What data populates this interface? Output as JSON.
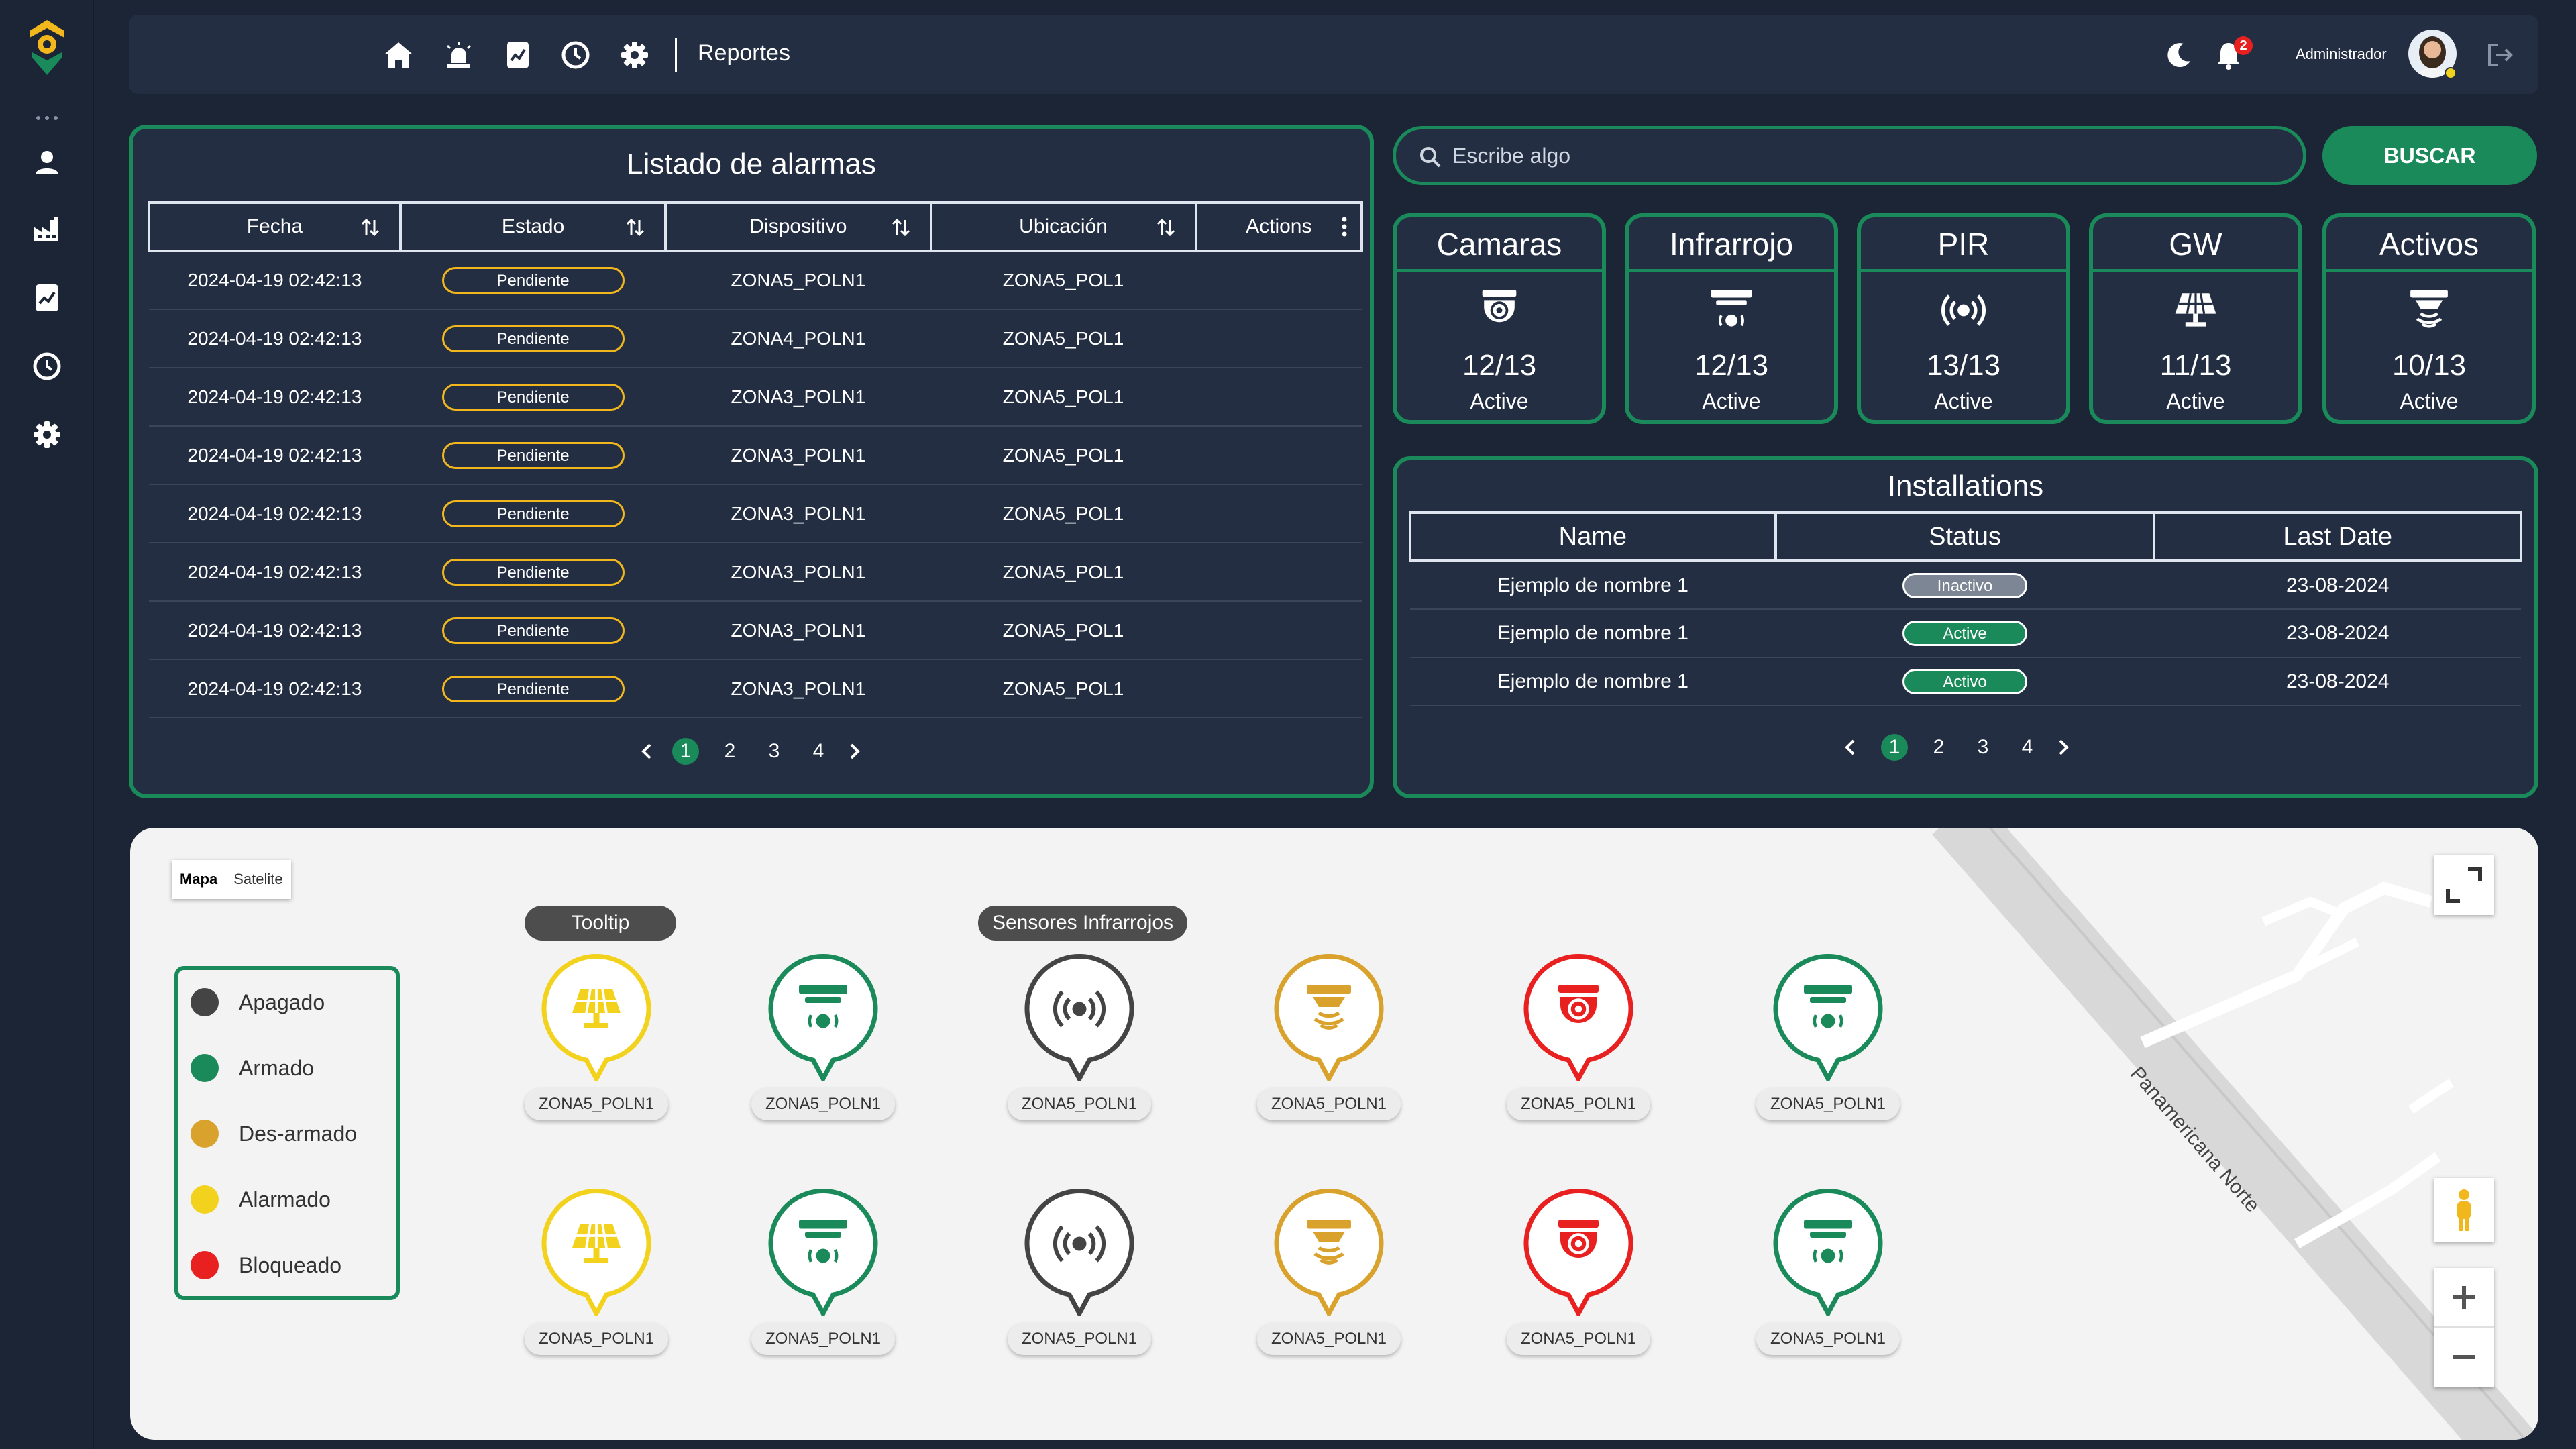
{
  "header": {
    "section_title": "Reportes",
    "user_name": "Administrador",
    "notification_count": "2"
  },
  "alarms": {
    "title": "Listado de alarmas",
    "columns": [
      "Fecha",
      "Estado",
      "Dispositivo",
      "Ubicación",
      "Actions"
    ],
    "rows": [
      {
        "fecha": "2024-04-19 02:42:13",
        "estado": "Pendiente",
        "dispositivo": "ZONA5_POLN1",
        "ubicacion": "ZONA5_POL1"
      },
      {
        "fecha": "2024-04-19 02:42:13",
        "estado": "Pendiente",
        "dispositivo": "ZONA4_POLN1",
        "ubicacion": "ZONA5_POL1"
      },
      {
        "fecha": "2024-04-19 02:42:13",
        "estado": "Pendiente",
        "dispositivo": "ZONA3_POLN1",
        "ubicacion": "ZONA5_POL1"
      },
      {
        "fecha": "2024-04-19 02:42:13",
        "estado": "Pendiente",
        "dispositivo": "ZONA3_POLN1",
        "ubicacion": "ZONA5_POL1"
      },
      {
        "fecha": "2024-04-19 02:42:13",
        "estado": "Pendiente",
        "dispositivo": "ZONA3_POLN1",
        "ubicacion": "ZONA5_POL1"
      },
      {
        "fecha": "2024-04-19 02:42:13",
        "estado": "Pendiente",
        "dispositivo": "ZONA3_POLN1",
        "ubicacion": "ZONA5_POL1"
      },
      {
        "fecha": "2024-04-19 02:42:13",
        "estado": "Pendiente",
        "dispositivo": "ZONA3_POLN1",
        "ubicacion": "ZONA5_POL1"
      },
      {
        "fecha": "2024-04-19 02:42:13",
        "estado": "Pendiente",
        "dispositivo": "ZONA3_POLN1",
        "ubicacion": "ZONA5_POL1"
      }
    ],
    "pages": [
      "1",
      "2",
      "3",
      "4"
    ]
  },
  "search": {
    "placeholder": "Escribe algo",
    "button_label": "BUSCAR"
  },
  "stats": [
    {
      "title": "Camaras",
      "value": "12/13",
      "sub": "Active",
      "icon": "dome-camera-icon"
    },
    {
      "title": "Infrarrojo",
      "value": "12/13",
      "sub": "Active",
      "icon": "infrared-sensor-icon"
    },
    {
      "title": "PIR",
      "value": "13/13",
      "sub": "Active",
      "icon": "wireless-signal-icon"
    },
    {
      "title": "GW",
      "value": "11/13",
      "sub": "Active",
      "icon": "solar-panel-icon"
    },
    {
      "title": "Activos",
      "value": "10/13",
      "sub": "Active",
      "icon": "ceiling-sensor-icon"
    }
  ],
  "installations": {
    "title": "Installations",
    "columns": [
      "Name",
      "Status",
      "Last Date"
    ],
    "rows": [
      {
        "name": "Ejemplo de nombre 1",
        "status": "Inactivo",
        "date": "23-08-2024"
      },
      {
        "name": "Ejemplo de nombre 1",
        "status": "Active",
        "date": "23-08-2024"
      },
      {
        "name": "Ejemplo de nombre 1",
        "status": "Activo",
        "date": "23-08-2024"
      }
    ],
    "pages": [
      "1",
      "2",
      "3",
      "4"
    ]
  },
  "map": {
    "map_types": [
      "Mapa",
      "Satelite"
    ],
    "road_label": "Panamericana Norte",
    "tooltip_labels": [
      "Tooltip",
      "Sensores Infrarrojos"
    ],
    "legend": [
      {
        "label": "Apagado",
        "color": "#444444"
      },
      {
        "label": "Armado",
        "color": "#1a8a5a"
      },
      {
        "label": "Des-armado",
        "color": "#d9a22c"
      },
      {
        "label": "Alarmado",
        "color": "#f2d21c"
      },
      {
        "label": "Bloqueado",
        "color": "#e82020"
      }
    ],
    "markers": [
      {
        "label": "ZONA5_POLN1",
        "icon": "solar-panel-icon",
        "status_color": "#f2d21c"
      },
      {
        "label": "ZONA5_POLN1",
        "icon": "infrared-sensor-icon",
        "status_color": "#1a8a5a"
      },
      {
        "label": "ZONA5_POLN1",
        "icon": "wireless-signal-icon",
        "status_color": "#444444"
      },
      {
        "label": "ZONA5_POLN1",
        "icon": "ceiling-sensor-icon",
        "status_color": "#d9a22c"
      },
      {
        "label": "ZONA5_POLN1",
        "icon": "dome-camera-icon",
        "status_color": "#e82020"
      },
      {
        "label": "ZONA5_POLN1",
        "icon": "infrared-sensor-icon",
        "status_color": "#1a8a5a"
      },
      {
        "label": "ZONA5_POLN1",
        "icon": "solar-panel-icon",
        "status_color": "#f2d21c"
      },
      {
        "label": "ZONA5_POLN1",
        "icon": "infrared-sensor-icon",
        "status_color": "#1a8a5a"
      },
      {
        "label": "ZONA5_POLN1",
        "icon": "wireless-signal-icon",
        "status_color": "#444444"
      },
      {
        "label": "ZONA5_POLN1",
        "icon": "ceiling-sensor-icon",
        "status_color": "#d9a22c"
      },
      {
        "label": "ZONA5_POLN1",
        "icon": "dome-camera-icon",
        "status_color": "#e82020"
      },
      {
        "label": "ZONA5_POLN1",
        "icon": "infrared-sensor-icon",
        "status_color": "#1a8a5a"
      }
    ]
  }
}
